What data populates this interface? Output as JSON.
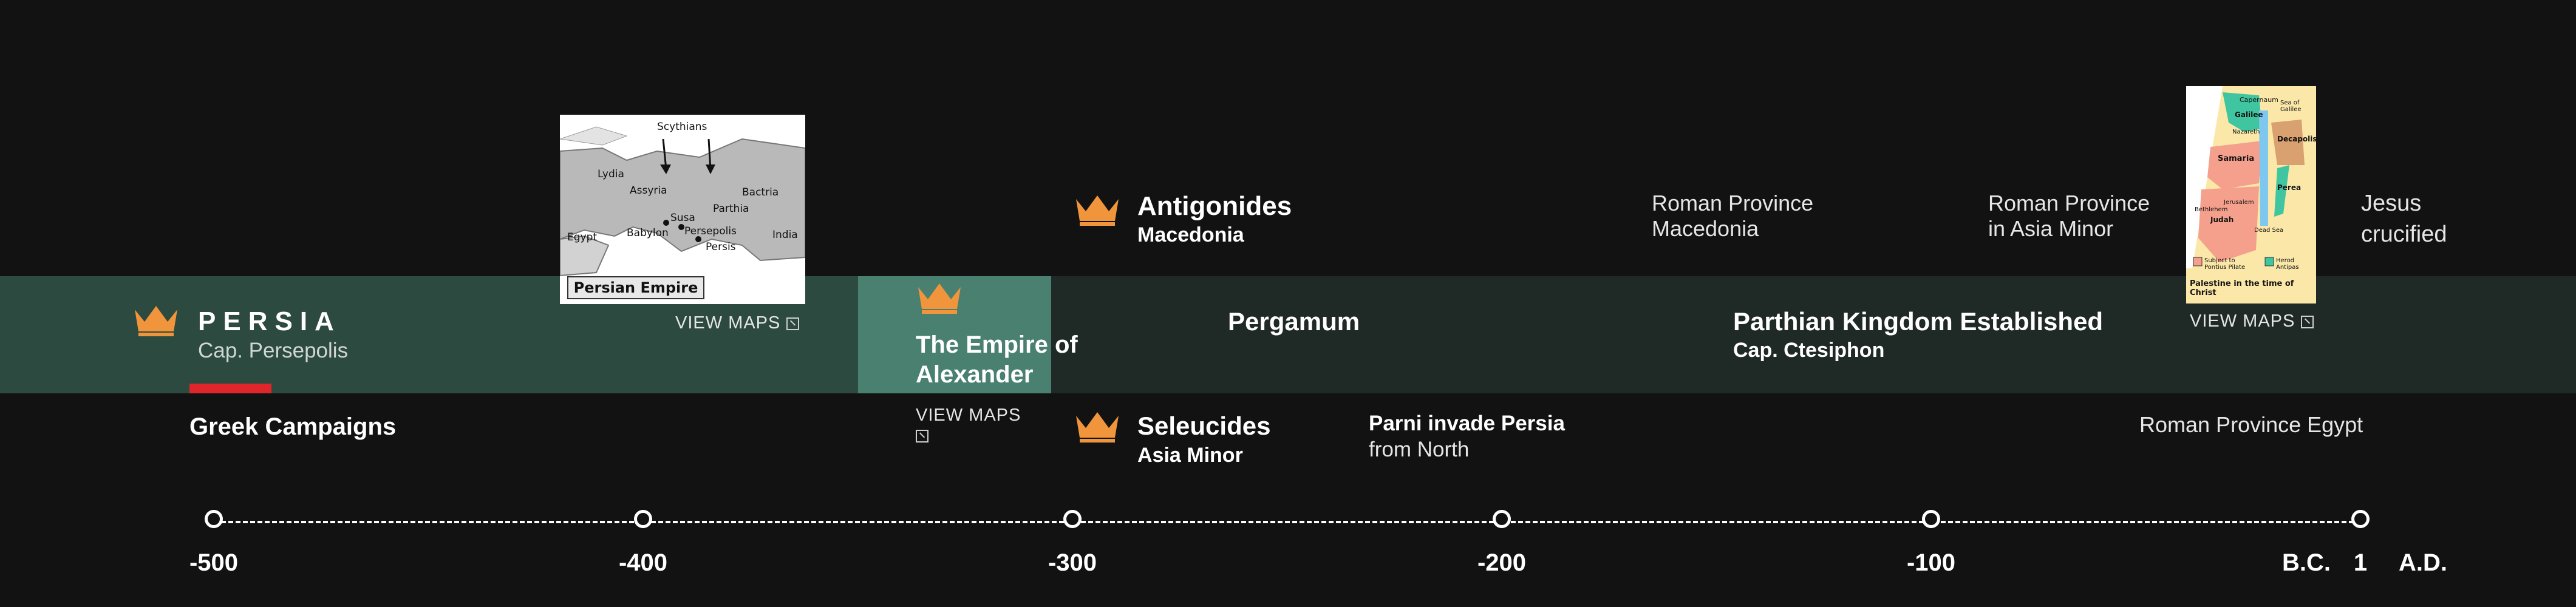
{
  "persia": {
    "title": "PERSIA",
    "capital": "Cap. Persepolis",
    "view_maps": "VIEW MAPS",
    "map_title": "Persian Empire",
    "map_labels": [
      "Scythians",
      "Lydia",
      "Assyria",
      "Bactria",
      "Parthia",
      "Susa",
      "Babylon",
      "Persepolis",
      "Egypt",
      "India",
      "Persis"
    ]
  },
  "greek_campaigns": "Greek Campaigns",
  "alexander": {
    "title_line1": "The Empire of",
    "title_line2": "Alexander",
    "view_maps": "VIEW MAPS"
  },
  "antigonides": {
    "title": "Antigonides",
    "subtitle": "Macedonia"
  },
  "seleucides": {
    "title": "Seleucides",
    "subtitle": "Asia Minor"
  },
  "pergamum": "Pergamum",
  "parni": {
    "line1": "Parni invade Persia",
    "line2": "from North"
  },
  "parthian": {
    "title": "Parthian Kingdom Established",
    "capital": "Cap. Ctesiphon"
  },
  "roman_macedonia": {
    "line1": "Roman Province",
    "line2": "Macedonia"
  },
  "roman_asia_minor": {
    "line1": "Roman Province",
    "line2": "in Asia Minor"
  },
  "roman_egypt": "Roman Province Egypt",
  "palestine": {
    "view_maps": "VIEW MAPS",
    "caption": "Palestine in the time of Christ",
    "labels": [
      "Capernaum",
      "Sea of Galilee",
      "Galilee",
      "Nazareth",
      "Samaria",
      "Decapolis",
      "Perea",
      "Jerusalem",
      "Bethlehem",
      "Judah",
      "Dead Sea",
      "Subject to Pontius Pilate",
      "Herod Antipas"
    ]
  },
  "jesus": {
    "line1": "Jesus",
    "line2": "crucified"
  },
  "timeline": {
    "ticks": [
      "-500",
      "-400",
      "-300",
      "-200",
      "-100",
      "1"
    ],
    "bc_label": "B.C.",
    "ad_label": "A.D."
  },
  "colors": {
    "background": "#121212",
    "band": "#1f2926",
    "persia_band": "#2c4a40",
    "alexander_band": "#4a8070",
    "crown": "#f0953c",
    "red_marker": "#e0262b"
  }
}
